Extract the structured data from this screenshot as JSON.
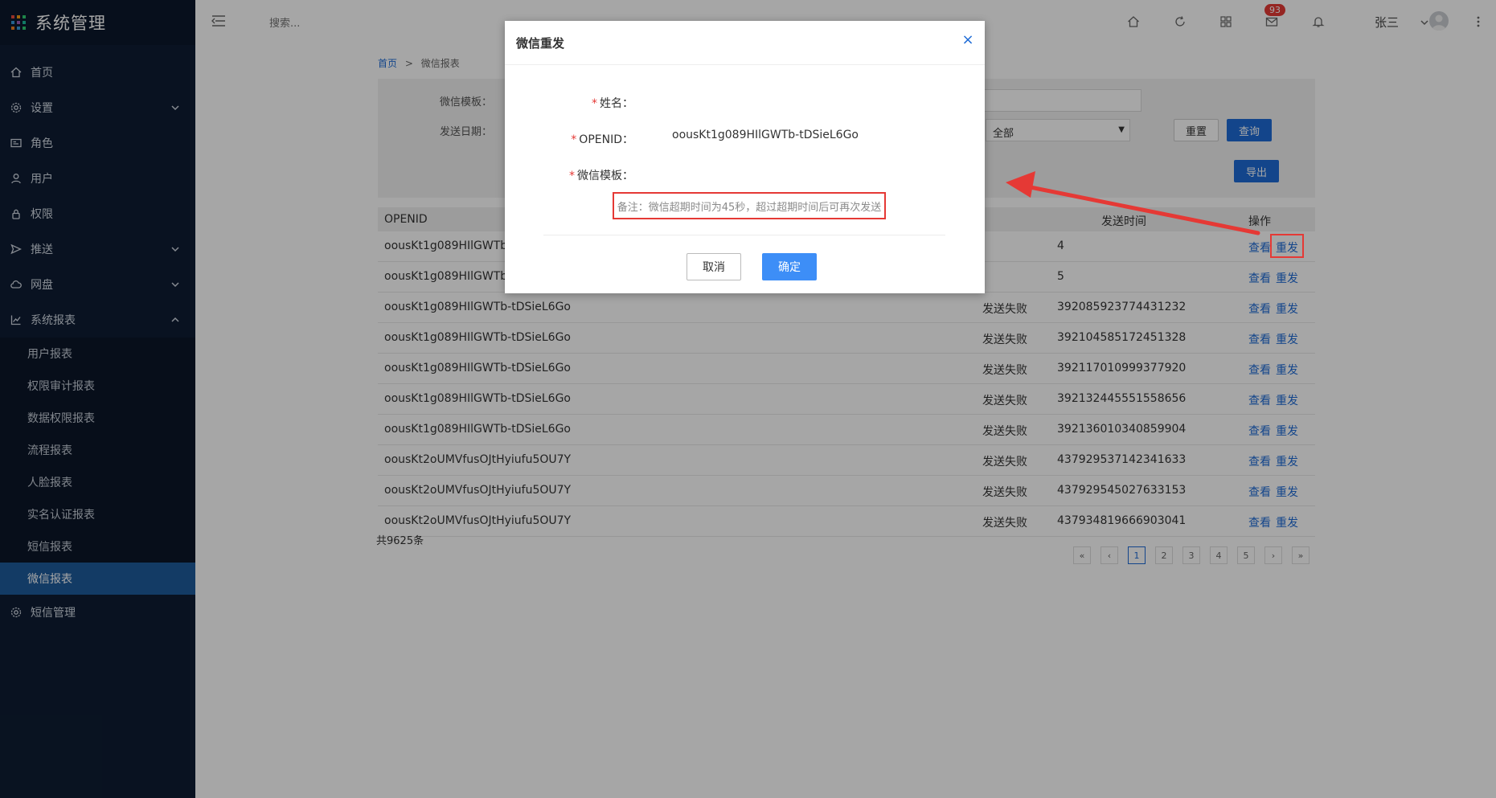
{
  "app": {
    "title": "系统管理"
  },
  "sidebar": {
    "items": [
      {
        "label": "首页",
        "icon": "home-icon"
      },
      {
        "label": "设置",
        "icon": "gear-icon"
      },
      {
        "label": "角色",
        "icon": "id-card-icon"
      },
      {
        "label": "用户",
        "icon": "user-icon"
      },
      {
        "label": "权限",
        "icon": "lock-icon"
      },
      {
        "label": "推送",
        "icon": "send-icon"
      },
      {
        "label": "网盘",
        "icon": "cloud-icon"
      },
      {
        "label": "系统报表",
        "icon": "chart-icon"
      }
    ],
    "sub_items": [
      {
        "label": "用户报表"
      },
      {
        "label": "权限审计报表"
      },
      {
        "label": "数据权限报表"
      },
      {
        "label": "流程报表"
      },
      {
        "label": "人脸报表"
      },
      {
        "label": "实名认证报表"
      },
      {
        "label": "短信报表"
      },
      {
        "label": "微信报表"
      }
    ],
    "last_item": {
      "label": "短信管理",
      "icon": "gear-icon"
    }
  },
  "header": {
    "search_placeholder": "搜索...",
    "mail_badge": "93",
    "user_name": "张三"
  },
  "breadcrumb": {
    "home": "首页",
    "separator": ">",
    "current": "微信报表"
  },
  "filter": {
    "template_label": "微信模板：",
    "date_label": "发送日期：",
    "status_value": "全部",
    "reset_label": "重置",
    "query_label": "查询",
    "export_label": "导出"
  },
  "table": {
    "headers": {
      "openid": "OPENID",
      "send_time": "发送时间",
      "op": "操作"
    },
    "rows": [
      {
        "openid": "oousKt1g089HIlGWTb",
        "status": "",
        "id": "4"
      },
      {
        "openid": "oousKt1g089HIlGWTb",
        "status": "",
        "id": "5"
      },
      {
        "openid": "oousKt1g089HIlGWTb-tDSieL6Go",
        "status": "发送失败",
        "id": "392085923774431232"
      },
      {
        "openid": "oousKt1g089HIlGWTb-tDSieL6Go",
        "status": "发送失败",
        "id": "392104585172451328"
      },
      {
        "openid": "oousKt1g089HIlGWTb-tDSieL6Go",
        "status": "发送失败",
        "id": "392117010999377920"
      },
      {
        "openid": "oousKt1g089HIlGWTb-tDSieL6Go",
        "status": "发送失败",
        "id": "392132445551558656"
      },
      {
        "openid": "oousKt1g089HIlGWTb-tDSieL6Go",
        "status": "发送失败",
        "id": "392136010340859904"
      },
      {
        "openid": "oousKt2oUMVfusOJtHyiufu5OU7Y",
        "status": "发送失败",
        "id": "437929537142341633"
      },
      {
        "openid": "oousKt2oUMVfusOJtHyiufu5OU7Y",
        "status": "发送失败",
        "id": "437929545027633153"
      },
      {
        "openid": "oousKt2oUMVfusOJtHyiufu5OU7Y",
        "status": "发送失败",
        "id": "437934819666903041"
      }
    ],
    "view_label": "查看",
    "resend_label": "重发"
  },
  "total": "共9625条",
  "pager": [
    "«",
    "‹",
    "1",
    "2",
    "3",
    "4",
    "5",
    "›",
    "»"
  ],
  "modal": {
    "title": "微信重发",
    "close": "×",
    "name_label": "姓名：",
    "openid_label": "OPENID：",
    "openid_value": "oousKt1g089HIlGWTb-tDSieL6Go",
    "template_label": "微信模板：",
    "note": "备注：微信超期时间为45秒，超过超期时间后可再次发送",
    "cancel_label": "取消",
    "ok_label": "确定",
    "required_mark": "*"
  },
  "colors": {
    "accent": "#1e6bd6",
    "sidebar_bg": "#0e1d33",
    "highlight": "#e53935"
  }
}
